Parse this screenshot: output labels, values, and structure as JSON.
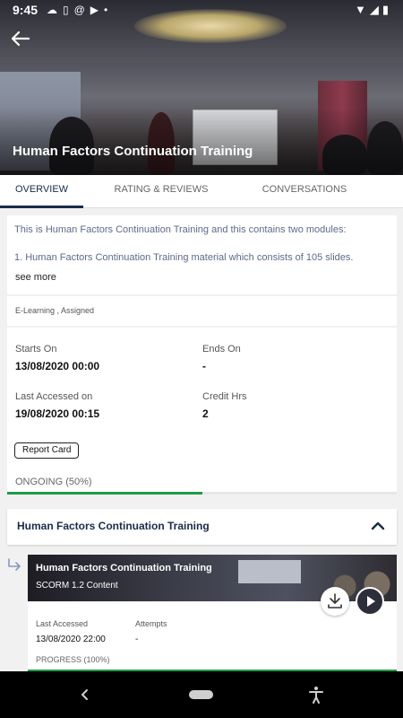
{
  "status_bar": {
    "time": "9:45",
    "left_icons": [
      "cloud-icon",
      "sim-icon",
      "at-icon",
      "youtube-icon",
      "dot-icon"
    ],
    "right_icons": [
      "wifi-icon",
      "signal-icon",
      "battery-icon"
    ]
  },
  "hero": {
    "title": "Human Factors Continuation Training"
  },
  "tabs": [
    {
      "label": "OVERVIEW",
      "active": true
    },
    {
      "label": "RATING & REVIEWS",
      "active": false
    },
    {
      "label": "CONVERSATIONS",
      "active": false
    }
  ],
  "overview": {
    "description_line1": "This is Human Factors Continuation Training and this contains two modules:",
    "description_line2": "1. Human Factors Continuation Training material which consists of 105 slides.",
    "see_more": "see more",
    "tags": "E-Learning , Assigned",
    "starts_on_label": "Starts On",
    "starts_on_value": "13/08/2020 00:00",
    "ends_on_label": "Ends On",
    "ends_on_value": "-",
    "last_accessed_label": "Last Accessed on",
    "last_accessed_value": "19/08/2020 00:15",
    "credit_hrs_label": "Credit Hrs",
    "credit_hrs_value": "2",
    "report_card_label": "Report Card",
    "status": "ONGOING (50%)",
    "progress_fraction": 0.5
  },
  "module": {
    "title": "Human Factors Continuation Training",
    "expanded": true
  },
  "content_item": {
    "title": "Human Factors Continuation Training",
    "type": "SCORM 1.2 Content",
    "last_accessed_label": "Last Accessed",
    "last_accessed_value": "13/08/2020 22:00",
    "attempts_label": "Attempts",
    "attempts_value": "-",
    "progress": "PROGRESS (100%)",
    "progress_fraction": 1.0
  },
  "colors": {
    "accent": "#1a2b4a",
    "progress": "#1d9c48"
  }
}
